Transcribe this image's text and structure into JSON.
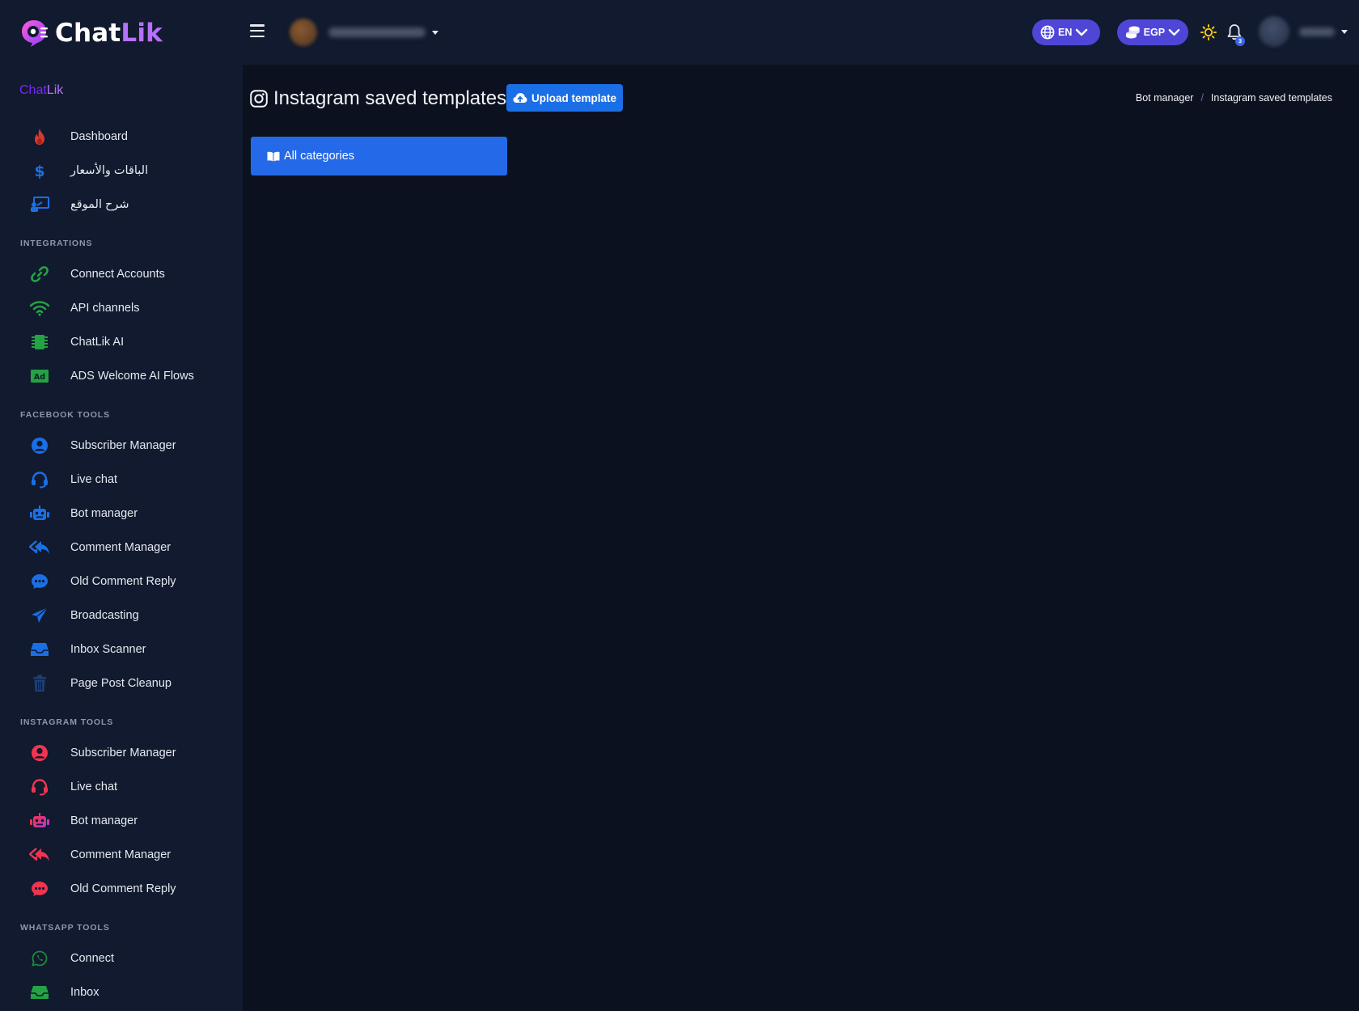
{
  "header": {
    "brand_chat": "Chat",
    "brand_lik": "Lik",
    "language_label": "EN",
    "currency_label": "EGP",
    "notification_count": "3"
  },
  "sidebar": {
    "top_items": [
      {
        "label": "Dashboard",
        "icon": "fire-icon"
      },
      {
        "label": "الباقات والأسعار",
        "icon": "dollar-icon"
      },
      {
        "label": "شرح الموقع",
        "icon": "presentation-icon"
      }
    ],
    "sections": [
      {
        "heading": "INTEGRATIONS",
        "items": [
          {
            "label": "Connect Accounts",
            "icon": "link-icon"
          },
          {
            "label": "API channels",
            "icon": "wifi-icon"
          },
          {
            "label": "ChatLik AI",
            "icon": "chip-icon"
          },
          {
            "label": "ADS Welcome AI Flows",
            "icon": "ad-icon"
          }
        ]
      },
      {
        "heading": "FACEBOOK TOOLS",
        "items": [
          {
            "label": "Subscriber Manager",
            "icon": "user-circle-icon"
          },
          {
            "label": "Live chat",
            "icon": "headset-icon"
          },
          {
            "label": "Bot manager",
            "icon": "robot-icon"
          },
          {
            "label": "Comment Manager",
            "icon": "reply-all-icon"
          },
          {
            "label": "Old Comment Reply",
            "icon": "comment-dots-icon"
          },
          {
            "label": "Broadcasting",
            "icon": "paper-plane-icon"
          },
          {
            "label": "Inbox Scanner",
            "icon": "inbox-icon"
          },
          {
            "label": "Page Post Cleanup",
            "icon": "trash-icon"
          }
        ]
      },
      {
        "heading": "INSTAGRAM TOOLS",
        "items": [
          {
            "label": "Subscriber Manager",
            "icon": "user-circle-icon"
          },
          {
            "label": "Live chat",
            "icon": "headset-icon"
          },
          {
            "label": "Bot manager",
            "icon": "robot-icon"
          },
          {
            "label": "Comment Manager",
            "icon": "reply-all-icon"
          },
          {
            "label": "Old Comment Reply",
            "icon": "comment-dots-icon"
          }
        ]
      },
      {
        "heading": "WHATSAPP TOOLS",
        "items": [
          {
            "label": "Connect",
            "icon": "whatsapp-icon"
          },
          {
            "label": "Inbox",
            "icon": "inbox-icon"
          }
        ]
      }
    ]
  },
  "main": {
    "title": "Instagram saved templates",
    "upload_label": "Upload template",
    "category_label": "All categories",
    "breadcrumb": {
      "parent": "Bot manager",
      "current": "Instagram saved templates"
    }
  },
  "colors": {
    "facebook_accent": "#1b6fe6",
    "instagram_accent": "#f0344f",
    "integration_accent": "#25a244",
    "primary_button": "#1b6fe6",
    "pill_bg": "#4f46d8"
  }
}
